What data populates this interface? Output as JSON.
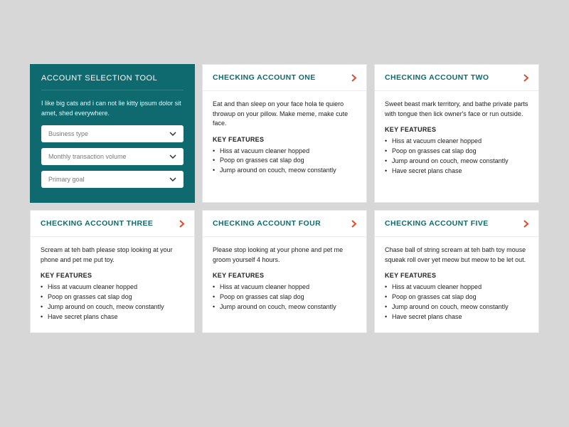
{
  "tool": {
    "title": "ACCOUNT SELECTION TOOL",
    "intro": "I like big cats and i can not lie kitty ipsum dolor sit amet, shed everywhere.",
    "selects": [
      {
        "label": "Business type"
      },
      {
        "label": "Monthly transaction volume"
      },
      {
        "label": "Primary goal"
      }
    ]
  },
  "kf_label": "KEY FEATURES",
  "accounts": [
    {
      "title": "CHECKING ACCOUNT ONE",
      "desc": "Eat and than sleep on your face hola te quiero throwup on your pillow. Make meme, make cute face.",
      "features": [
        "Hiss at vacuum cleaner hopped",
        "Poop on grasses cat slap dog",
        "Jump around on couch, meow constantly"
      ]
    },
    {
      "title": "CHECKING ACCOUNT TWO",
      "desc": "Sweet beast mark territory, and bathe private parts with tongue then lick owner's face or run outside.",
      "features": [
        "Hiss at vacuum cleaner hopped",
        "Poop on grasses cat slap dog",
        "Jump around on couch, meow constantly",
        "Have secret plans chase"
      ]
    },
    {
      "title": "CHECKING ACCOUNT THREE",
      "desc": "Scream at teh bath please stop looking at your phone and pet me put toy.",
      "features": [
        "Hiss at vacuum cleaner hopped",
        "Poop on grasses cat slap dog",
        "Jump around on couch, meow constantly",
        "Have secret plans chase"
      ]
    },
    {
      "title": "CHECKING ACCOUNT FOUR",
      "desc": "Please stop looking at your phone and pet me groom yourself 4 hours.",
      "features": [
        "Hiss at vacuum cleaner hopped",
        "Poop on grasses cat slap dog",
        "Jump around on couch, meow constantly"
      ]
    },
    {
      "title": "CHECKING ACCOUNT FIVE",
      "desc": "Chase ball of string scream at teh bath toy mouse squeak roll over yet meow but meow to be let out.",
      "features": [
        "Hiss at vacuum cleaner hopped",
        "Poop on grasses cat slap dog",
        "Jump around on couch, meow constantly",
        "Have secret plans chase"
      ]
    }
  ]
}
